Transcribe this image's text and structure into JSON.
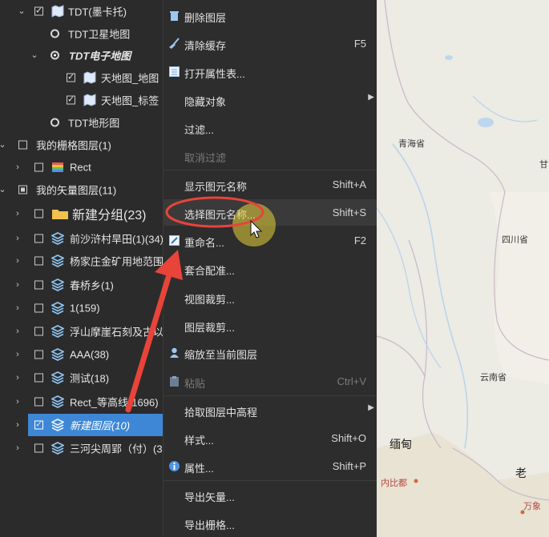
{
  "tree": {
    "rows": [
      {
        "label": "TDT(墨卡托)"
      },
      {
        "label": "TDT卫星地图"
      },
      {
        "label": "TDT电子地图"
      },
      {
        "label": "天地图_地图"
      },
      {
        "label": "天地图_标签"
      },
      {
        "label": "TDT地形图"
      },
      {
        "label": "我的栅格图层(1)"
      },
      {
        "label": "Rect"
      },
      {
        "label": "我的矢量图层(11)"
      },
      {
        "label": "新建分组(23)"
      },
      {
        "label": "前沙浒村旱田(1)(34)"
      },
      {
        "label": "杨家庄金矿用地范围"
      },
      {
        "label": "春桥乡(1)"
      },
      {
        "label": "1(159)"
      },
      {
        "label": "浮山摩崖石刻及古以"
      },
      {
        "label": "AAA(38)"
      },
      {
        "label": "测试(18)"
      },
      {
        "label": "Rect_等高线(1696)"
      },
      {
        "label": "新建图层(10)"
      },
      {
        "label": "三河尖周郢（付）(3"
      }
    ]
  },
  "menu": {
    "items": [
      {
        "label": "删除图层",
        "shortcut": ""
      },
      {
        "label": "清除缓存",
        "shortcut": "F5"
      },
      {
        "label": "打开属性表...",
        "shortcut": ""
      },
      {
        "label": "隐藏对象",
        "shortcut": ""
      },
      {
        "label": "过滤...",
        "shortcut": ""
      },
      {
        "label": "取消过滤",
        "shortcut": ""
      },
      {
        "label": "显示图元名称",
        "shortcut": "Shift+A"
      },
      {
        "label": "选择图元名称...",
        "shortcut": "Shift+S"
      },
      {
        "label": "重命名...",
        "shortcut": "F2"
      },
      {
        "label": "套合配准...",
        "shortcut": ""
      },
      {
        "label": "视图裁剪...",
        "shortcut": ""
      },
      {
        "label": "图层裁剪...",
        "shortcut": ""
      },
      {
        "label": "缩放至当前图层",
        "shortcut": ""
      },
      {
        "label": "粘贴",
        "shortcut": "Ctrl+V"
      },
      {
        "label": "拾取图层中高程",
        "shortcut": ""
      },
      {
        "label": "样式...",
        "shortcut": "Shift+O"
      },
      {
        "label": "属性...",
        "shortcut": "Shift+P"
      },
      {
        "label": "导出矢量...",
        "shortcut": ""
      },
      {
        "label": "导出栅格...",
        "shortcut": ""
      }
    ]
  },
  "map": {
    "labels": {
      "qinghai": "青海省",
      "gan": "甘",
      "sichuan": "四川省",
      "yunnan": "云南省",
      "miandian": "缅甸",
      "lao": "老",
      "naypyidaw": "内比都",
      "vientiane": "万象"
    }
  },
  "colors": {
    "accent": "#3d87d6",
    "annotation": "#e8443a",
    "highlight": "#e7d23a"
  }
}
